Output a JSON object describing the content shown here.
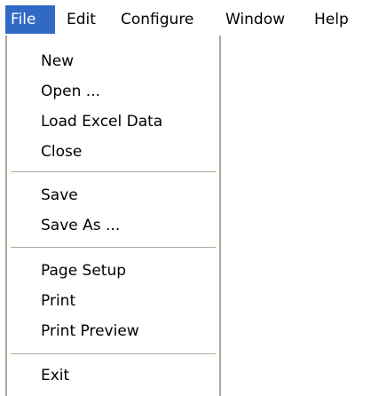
{
  "menubar": {
    "items": [
      {
        "label": "File"
      },
      {
        "label": "Edit"
      },
      {
        "label": "Configure"
      },
      {
        "label": "Window"
      },
      {
        "label": "Help"
      }
    ],
    "active_item": "File"
  },
  "file_menu": {
    "new": "New",
    "open": "Open ...",
    "load_excel_data": "Load Excel Data",
    "close": "Close",
    "save": "Save",
    "save_as": "Save As ...",
    "page_setup": "Page Setup",
    "print": "Print",
    "print_preview": "Print Preview",
    "exit": "Exit"
  },
  "colors": {
    "highlight": "#316ac5",
    "highlight_text": "#ffffff",
    "menu_border": "#aca899"
  }
}
